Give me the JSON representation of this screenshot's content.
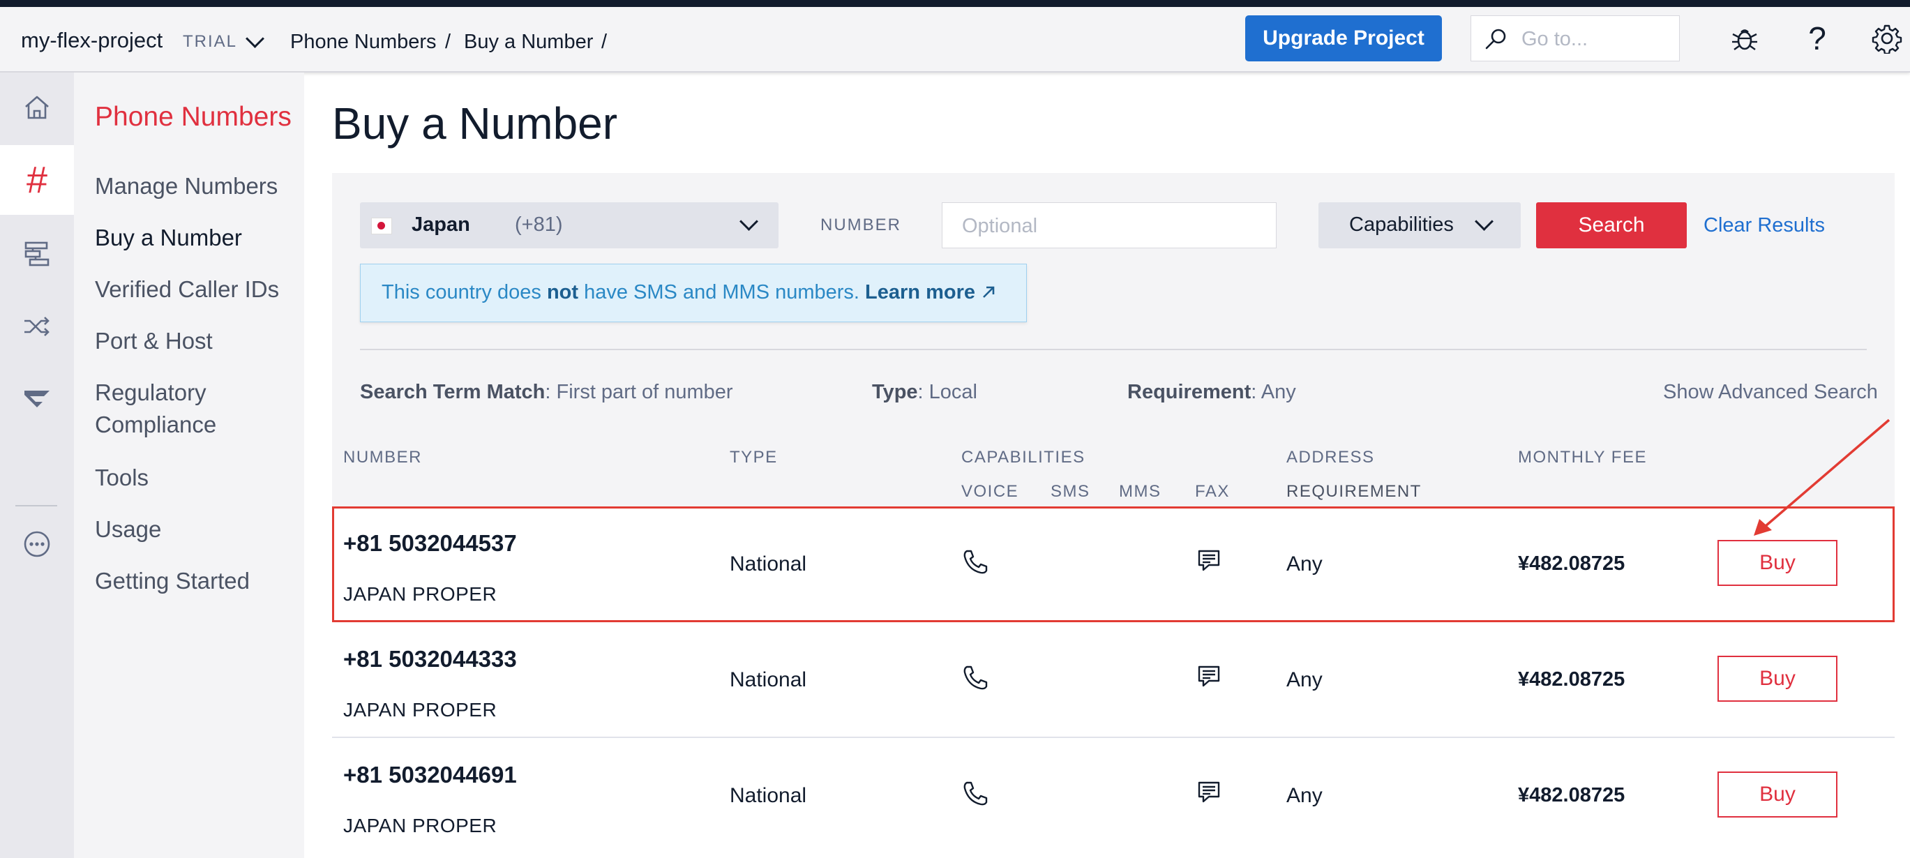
{
  "header": {
    "project_name": "my-flex-project",
    "plan_badge": "TRIAL",
    "breadcrumb": [
      "Phone Numbers",
      "Buy a Number"
    ],
    "breadcrumb_separator": "/",
    "upgrade_label": "Upgrade Project",
    "goto_placeholder": "Go to...",
    "icons": [
      "search-icon",
      "debug-bug-icon",
      "help-icon",
      "settings-gear-icon"
    ]
  },
  "rail": {
    "items": [
      "home-icon",
      "phone-numbers-hash-icon",
      "studio-flow-icon",
      "routing-shuffle-icon",
      "flex-icon",
      "more-icon"
    ],
    "active_index": 1
  },
  "sidebar": {
    "title": "Phone Numbers",
    "items": [
      {
        "label": "Manage Numbers"
      },
      {
        "label": "Buy a Number",
        "active": true
      },
      {
        "label": "Verified Caller IDs"
      },
      {
        "label": "Port & Host"
      },
      {
        "label": "Regulatory Compliance"
      },
      {
        "label": "Tools"
      },
      {
        "label": "Usage"
      },
      {
        "label": "Getting Started"
      }
    ]
  },
  "page": {
    "title": "Buy a Number"
  },
  "search": {
    "country_name": "Japan",
    "country_code": "(+81)",
    "number_label": "NUMBER",
    "number_placeholder": "Optional",
    "number_value": "",
    "capabilities_label": "Capabilities",
    "search_label": "Search",
    "clear_label": "Clear Results"
  },
  "notice": {
    "text_before": "This country does ",
    "text_bold": "not",
    "text_after": " have SMS and MMS numbers. ",
    "link": "Learn more"
  },
  "filters": {
    "match_label": "Search Term Match",
    "match_value": ": First part of number",
    "type_label": "Type",
    "type_value": ": Local",
    "requirement_label": "Requirement",
    "requirement_value": ": Any",
    "advanced": "Show Advanced Search"
  },
  "table": {
    "headers": {
      "number": "NUMBER",
      "type": "TYPE",
      "capabilities": "CAPABILITIES",
      "voice": "VOICE",
      "sms": "SMS",
      "mms": "MMS",
      "fax": "FAX",
      "address": "ADDRESS",
      "requirement": "REQUIREMENT",
      "monthly_fee": "MONTHLY FEE"
    },
    "rows": [
      {
        "number": "+81 5032044537",
        "region": "JAPAN PROPER",
        "type": "National",
        "voice": true,
        "sms": false,
        "mms": false,
        "fax": true,
        "address_requirement": "Any",
        "monthly_fee": "¥482.08725",
        "action": "Buy",
        "highlighted": true
      },
      {
        "number": "+81 5032044333",
        "region": "JAPAN PROPER",
        "type": "National",
        "voice": true,
        "sms": false,
        "mms": false,
        "fax": true,
        "address_requirement": "Any",
        "monthly_fee": "¥482.08725",
        "action": "Buy",
        "highlighted": false
      },
      {
        "number": "+81 5032044691",
        "region": "JAPAN PROPER",
        "type": "National",
        "voice": true,
        "sms": false,
        "mms": false,
        "fax": true,
        "address_requirement": "Any",
        "monthly_fee": "¥482.08725",
        "action": "Buy",
        "highlighted": false
      }
    ]
  },
  "colors": {
    "accent_red": "#e0303f",
    "link_blue": "#1f6fd0",
    "highlight_outline": "#e23b33",
    "notice_bg": "#e0f1fb"
  }
}
